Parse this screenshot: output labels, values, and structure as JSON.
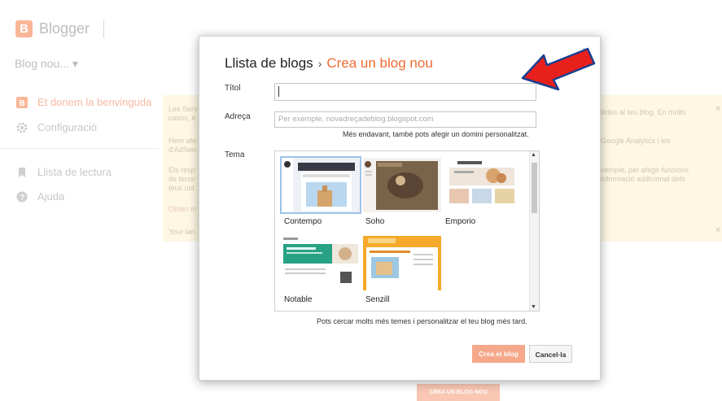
{
  "app": {
    "title": "Blogger",
    "logo_letter": "B"
  },
  "blog_selector": {
    "label": "Blog nou...",
    "caret": "▾"
  },
  "sidebar": {
    "items": [
      {
        "label": "Et donem la benvinguda"
      },
      {
        "label": "Configuració"
      },
      {
        "label": "Llista de lectura"
      },
      {
        "label": "Ajuda"
      }
    ]
  },
  "background": {
    "notice_left": [
      "Les Serv",
      "casos, e",
      "Hem afe",
      "d'AdSen",
      "Els resp",
      "de terce",
      "teus ust",
      "Obtén m",
      "Your lan"
    ],
    "notice_right": [
      "llides al teu blog. En molts",
      "Google Analytics i les",
      "xemple, per afegir funcions",
      "informació addicional dels"
    ],
    "create_button": "CREA UN BLOG NOU"
  },
  "modal": {
    "breadcrumb": {
      "parent": "Llista de blogs",
      "separator": "›",
      "current": "Crea un blog nou"
    },
    "close": "×",
    "title_label": "Títol",
    "title_value": "",
    "address_label": "Adreça",
    "address_placeholder": "Per exemple, novadreçadeblog.blogspot.com",
    "address_hint": "Més endavant, també pots afegir un domini personalitzat.",
    "theme_label": "Tema",
    "themes": [
      {
        "name": "Contempo",
        "selected": true
      },
      {
        "name": "Soho",
        "selected": false
      },
      {
        "name": "Emporio",
        "selected": false
      },
      {
        "name": "Notable",
        "selected": false
      },
      {
        "name": "Senzill",
        "selected": false
      }
    ],
    "themes_note": "Pots cercar molts més temes i personalitzar el teu blog més tard.",
    "create_button": "Crea el blog",
    "cancel_button": "Cancel·la"
  },
  "colors": {
    "accent": "#f26b34",
    "arrow": "#e8201b",
    "notice_bg": "#fdf7e3"
  }
}
